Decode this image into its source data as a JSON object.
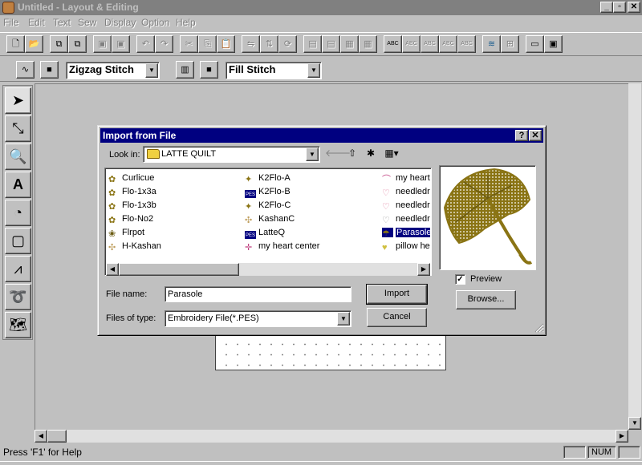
{
  "window": {
    "title": "Untitled - Layout & Editing",
    "controls": {
      "minimize": "_",
      "maximize": "▫",
      "close": "✕"
    }
  },
  "menu": [
    "File",
    "Edit",
    "Text",
    "Sew",
    "Display",
    "Option",
    "Help"
  ],
  "toolbar2": {
    "stitch_type": "Zigzag Stitch",
    "fill_type": "Fill Stitch"
  },
  "dialog": {
    "title": "Import from File",
    "help_btn": "?",
    "close_btn": "✕",
    "look_in_label": "Look in:",
    "look_in_value": "LATTE QUILT",
    "files": [
      {
        "name": "Curlicue",
        "icon": "stitch-icon"
      },
      {
        "name": "Flo-1x3a",
        "icon": "stitch-icon"
      },
      {
        "name": "Flo-1x3b",
        "icon": "stitch-icon"
      },
      {
        "name": "Flo-No2",
        "icon": "stitch-icon"
      },
      {
        "name": "Flrpot",
        "icon": "stitch-icon"
      },
      {
        "name": "H-Kashan",
        "icon": "stitch-icon"
      },
      {
        "name": "K2Flo-A",
        "icon": "stitch-icon"
      },
      {
        "name": "K2Flo-B",
        "icon": "pes-icon"
      },
      {
        "name": "K2Flo-C",
        "icon": "stitch-icon"
      },
      {
        "name": "KashanC",
        "icon": "stitch-icon"
      },
      {
        "name": "LatteQ",
        "icon": "pes-icon"
      },
      {
        "name": "my heart center",
        "icon": "stitch-icon"
      },
      {
        "name": "my heart",
        "icon": "stitch-icon"
      },
      {
        "name": "needledre",
        "icon": "heart-icon"
      },
      {
        "name": "needledre",
        "icon": "heart-icon"
      },
      {
        "name": "needledre",
        "icon": "heart-icon"
      },
      {
        "name": "Parasole",
        "icon": "stitch-icon",
        "selected": true
      },
      {
        "name": "pillow hea",
        "icon": "heart-icon"
      }
    ],
    "file_name_label": "File name:",
    "file_name_value": "Parasole",
    "files_of_type_label": "Files of type:",
    "files_of_type_value": "Embroidery File(*.PES)",
    "import_btn": "Import",
    "cancel_btn": "Cancel",
    "preview_label": "Preview",
    "preview_checked": "✓",
    "browse_btn": "Browse..."
  },
  "status": {
    "help_text": "Press 'F1' for Help",
    "num": "NUM"
  },
  "colors": {
    "dialog_titlebar": "#000080",
    "embroidery": "#8a7414"
  }
}
